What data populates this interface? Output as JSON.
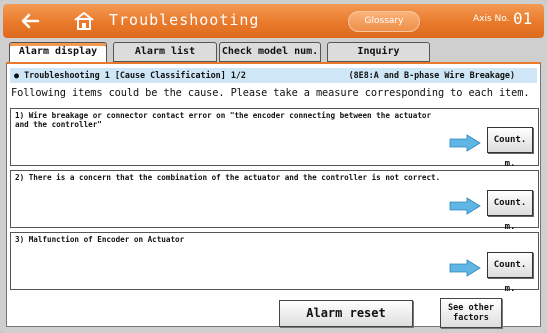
{
  "header": {
    "back_icon": "arrow-left-icon",
    "home_icon": "home-icon",
    "title": "Troubleshooting",
    "glossary_label": "Glossary",
    "axis_label": "Axis No.",
    "axis_number": "01",
    "accent_color": "#e97a2c"
  },
  "tabs": [
    {
      "label": "Alarm display",
      "active": true
    },
    {
      "label": "Alarm list",
      "active": false
    },
    {
      "label": "Check model num.",
      "active": false
    },
    {
      "label": "Inquiry",
      "active": false
    }
  ],
  "panel": {
    "heading_left": "● Troubleshooting 1 [Cause Classification] 1/2",
    "heading_right": "(8E8:A and B-phase Wire Breakage)",
    "intro": "Following items could be the cause. Please take a measure corresponding to each item.",
    "causes": [
      {
        "text": "1) Wire breakage or connector contact error on \"the encoder connecting between the actuator and the controller\"",
        "button": "Count. m."
      },
      {
        "text": "2) There is a concern that the combination of the actuator and the controller is not correct.",
        "button": "Count. m."
      },
      {
        "text": "3) Malfunction of Encoder on Actuator",
        "button": "Count. m."
      }
    ],
    "arrow_color": "#5fb6e4"
  },
  "footer": {
    "alarm_reset": "Alarm reset",
    "see_other_line1": "See other",
    "see_other_line2": "factors"
  }
}
